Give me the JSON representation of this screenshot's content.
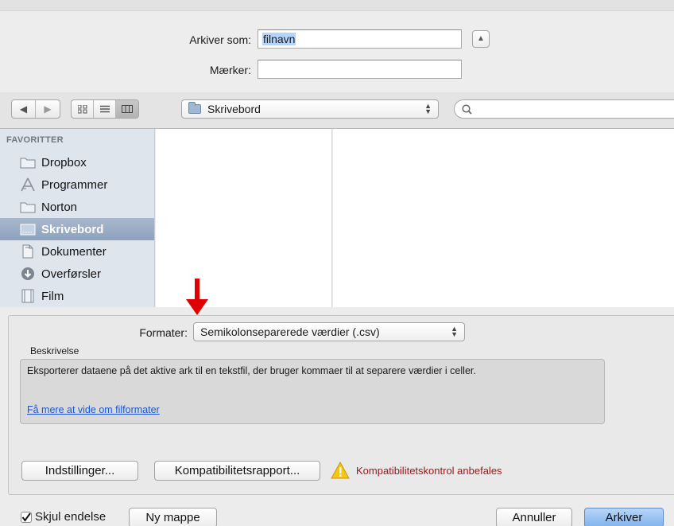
{
  "save": {
    "label": "Arkiver som:",
    "filename": "filnavn",
    "tags_label": "Mærker:",
    "tags_value": ""
  },
  "toolbar": {
    "location": "Skrivebord",
    "search_value": ""
  },
  "sidebar": {
    "header": "FAVORITTER",
    "items": [
      {
        "label": "Dropbox",
        "icon": "folder-icon"
      },
      {
        "label": "Programmer",
        "icon": "applications-icon"
      },
      {
        "label": "Norton",
        "icon": "folder-icon"
      },
      {
        "label": "Skrivebord",
        "icon": "desktop-icon",
        "selected": true
      },
      {
        "label": "Dokumenter",
        "icon": "documents-icon"
      },
      {
        "label": "Overførsler",
        "icon": "downloads-icon"
      },
      {
        "label": "Film",
        "icon": "film-icon"
      }
    ]
  },
  "format": {
    "label": "Formater:",
    "selected": "Semikolonseparerede værdier (.csv)",
    "description_label": "Beskrivelse",
    "description": "Eksporterer dataene på det aktive ark til en tekstfil, der bruger kommaer til at separere værdier i celler.",
    "learn_more": "Få mere at vide om filformater",
    "options_button": "Indstillinger...",
    "compat_button": "Kompatibilitetsrapport...",
    "compat_warning": "Kompatibilitetskontrol anbefales"
  },
  "bottom": {
    "hide_extension": "Skjul endelse",
    "hide_extension_checked": true,
    "new_folder": "Ny mappe",
    "cancel": "Annuller",
    "save": "Arkiver"
  },
  "colors": {
    "annotation_arrow": "#e00000",
    "sidebar_selected": "#8ea2bd",
    "warning": "#a01818",
    "link": "#1a56d6"
  }
}
